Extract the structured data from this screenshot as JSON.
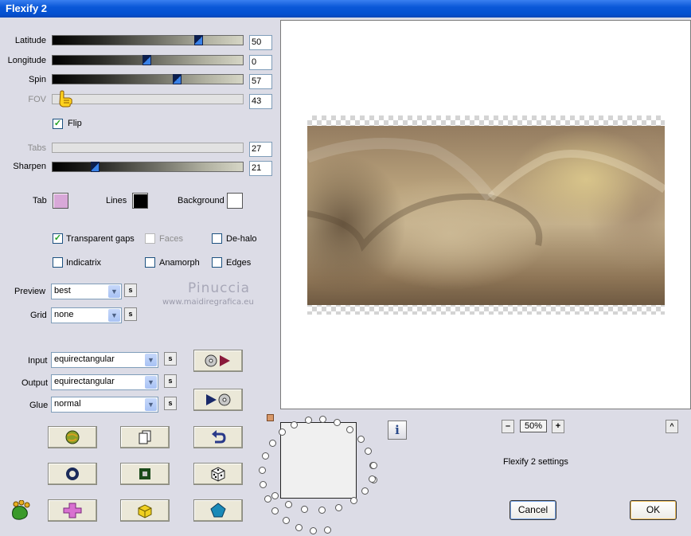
{
  "window": {
    "title": "Flexify 2"
  },
  "sliders": [
    {
      "label": "Latitude",
      "value": "50",
      "fraction": 0.76,
      "enabled": true
    },
    {
      "label": "Longitude",
      "value": "0",
      "fraction": 0.5,
      "enabled": true
    },
    {
      "label": "Spin",
      "value": "57",
      "fraction": 0.65,
      "enabled": true
    },
    {
      "label": "FOV",
      "value": "43",
      "fraction": 0.04,
      "enabled": false
    },
    {
      "label": "Tabs",
      "value": "27",
      "fraction": 0,
      "enabled": false
    },
    {
      "label": "Sharpen",
      "value": "21",
      "fraction": 0.21,
      "enabled": true
    }
  ],
  "flip": {
    "label": "Flip",
    "checked": true
  },
  "colors": {
    "tab": {
      "label": "Tab",
      "color": "#d8a8d8"
    },
    "lines": {
      "label": "Lines",
      "color": "#000000"
    },
    "background": {
      "label": "Background",
      "color": "#ffffff"
    }
  },
  "options": {
    "transparent_gaps": {
      "label": "Transparent gaps",
      "checked": true
    },
    "faces": {
      "label": "Faces",
      "checked": false,
      "enabled": false
    },
    "de_halo": {
      "label": "De-halo",
      "checked": false
    },
    "indicatrix": {
      "label": "Indicatrix",
      "checked": false
    },
    "anamorph": {
      "label": "Anamorph",
      "checked": false
    },
    "edges": {
      "label": "Edges",
      "checked": false
    }
  },
  "preview_mode": {
    "label": "Preview",
    "value": "best"
  },
  "grid": {
    "label": "Grid",
    "value": "none"
  },
  "input": {
    "label": "Input",
    "value": "equirectangular"
  },
  "output": {
    "label": "Output",
    "value": "equirectangular"
  },
  "glue": {
    "label": "Glue",
    "value": "normal"
  },
  "small_button": "s",
  "watermark": {
    "line1": "Pinuccia",
    "line2": "www.maidiregrafica.eu"
  },
  "zoom": {
    "minus": "–",
    "value": "50%",
    "plus": "+"
  },
  "scroll_up": "^",
  "info": "i",
  "settings_name": "Flexify 2 settings",
  "buttons": {
    "cancel": "Cancel",
    "ok": "OK"
  }
}
